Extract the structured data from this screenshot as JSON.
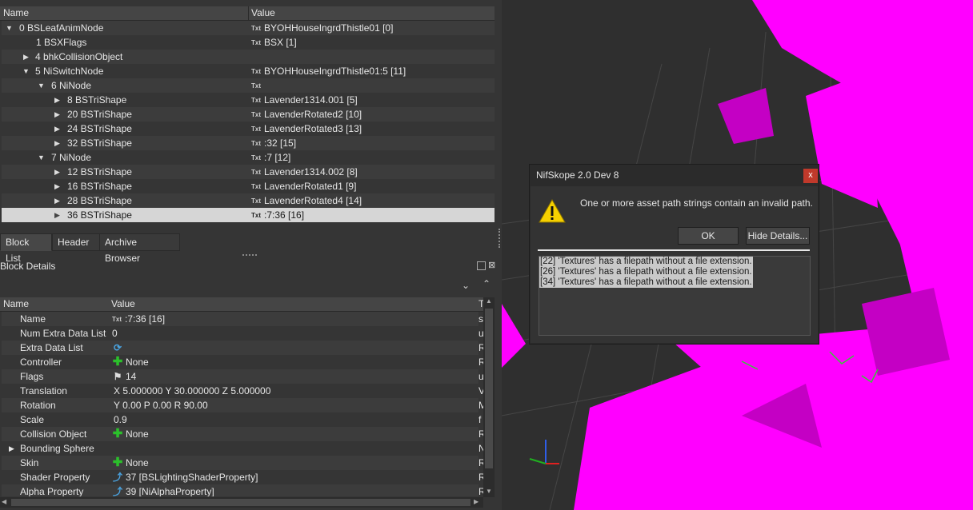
{
  "block_tree": {
    "header_name": "Name",
    "header_value": "Value",
    "rows": [
      {
        "label": "0 BSLeafAnimNode",
        "value": "BYOHHouseIngrdThistle01 [0]"
      },
      {
        "label": "1 BSXFlags",
        "value": "BSX [1]"
      },
      {
        "label": "4 bhkCollisionObject",
        "value": ""
      },
      {
        "label": "5 NiSwitchNode",
        "value": "BYOHHouseIngrdThistle01:5 [11]"
      },
      {
        "label": "6 NiNode",
        "value": ""
      },
      {
        "label": "8 BSTriShape",
        "value": "Lavender1314.001 [5]"
      },
      {
        "label": "20 BSTriShape",
        "value": "LavenderRotated2 [10]"
      },
      {
        "label": "24 BSTriShape",
        "value": "LavenderRotated3 [13]"
      },
      {
        "label": "32 BSTriShape",
        "value": ":32 [15]"
      },
      {
        "label": "7 NiNode",
        "value": ":7 [12]"
      },
      {
        "label": "12 BSTriShape",
        "value": "Lavender1314.002 [8]"
      },
      {
        "label": "16 BSTriShape",
        "value": "LavenderRotated1 [9]"
      },
      {
        "label": "28 BSTriShape",
        "value": "LavenderRotated4 [14]"
      },
      {
        "label": "36 BSTriShape",
        "value": ":7:36 [16]"
      }
    ],
    "txt_badge": "Txt"
  },
  "tabs": [
    "Block List",
    "Header",
    "Archive Browser"
  ],
  "block_details": {
    "title": "Block Details",
    "header_name": "Name",
    "header_value": "Value",
    "header_type": "T",
    "rows": [
      {
        "name": "Name",
        "value": ":7:36 [16]",
        "type": "s",
        "icon": "txt"
      },
      {
        "name": "Num Extra Data List",
        "value": "0",
        "type": "u",
        "icon": ""
      },
      {
        "name": "Extra Data List",
        "value": "",
        "type": "R",
        "icon": "recycle-icon"
      },
      {
        "name": "Controller",
        "value": "None",
        "type": "R",
        "icon": "plus-icon"
      },
      {
        "name": "Flags",
        "value": "14",
        "type": "u",
        "icon": "flag-icon"
      },
      {
        "name": "Translation",
        "value": "X 5.000000 Y 30.000000 Z 5.000000",
        "type": "V",
        "icon": ""
      },
      {
        "name": "Rotation",
        "value": "Y 0.00 P 0.00 R 90.00",
        "type": "M",
        "icon": ""
      },
      {
        "name": "Scale",
        "value": "0.9",
        "type": "f",
        "icon": ""
      },
      {
        "name": "Collision Object",
        "value": "None",
        "type": "R",
        "icon": "plus-icon"
      },
      {
        "name": "Bounding Sphere",
        "value": "",
        "type": "N",
        "icon": ""
      },
      {
        "name": "Skin",
        "value": "None",
        "type": "R",
        "icon": "plus-icon"
      },
      {
        "name": "Shader Property",
        "value": "37 [BSLightingShaderProperty]",
        "type": "R",
        "icon": "link-icon"
      },
      {
        "name": "Alpha Property",
        "value": "39 [NiAlphaProperty]",
        "type": "R",
        "icon": "link-icon"
      }
    ]
  },
  "dialog": {
    "title": "NifSkope 2.0 Dev 8",
    "close": "x",
    "message": "One or more asset path strings contain an invalid path.",
    "ok_label": "OK",
    "hide_details_label": "Hide Details...",
    "details": [
      "[22] 'Textures' has a filepath without a file extension.",
      "[26] 'Textures' has a filepath without a file extension.",
      "[34] 'Textures' has a filepath without a file extension."
    ]
  },
  "colors": {
    "mesh": "#ff00ff",
    "accent_selected": "#d6d6d6",
    "warning": "#f5d000"
  }
}
